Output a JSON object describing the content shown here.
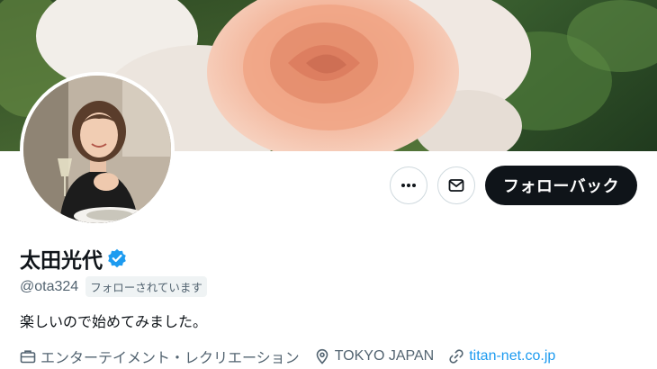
{
  "profile": {
    "display_name": "太田光代",
    "handle": "@ota324",
    "follows_you_label": "フォローされています",
    "bio": "楽しいので始めてみました。",
    "category": "エンターテイメント・レクリエーション",
    "location": "TOKYO JAPAN",
    "website": "titan-net.co.jp"
  },
  "actions": {
    "follow_back_label": "フォローバック",
    "more_icon": "more-dots-icon",
    "message_icon": "envelope-icon"
  },
  "icons": {
    "verified": "verified-badge-icon",
    "category": "briefcase-icon",
    "location": "location-pin-icon",
    "website": "link-icon"
  },
  "colors": {
    "primary_text": "#0f1419",
    "secondary_text": "#536471",
    "link": "#1d9bf0",
    "follow_button_bg": "#0f1419",
    "verified_badge": "#1d9bf0"
  }
}
